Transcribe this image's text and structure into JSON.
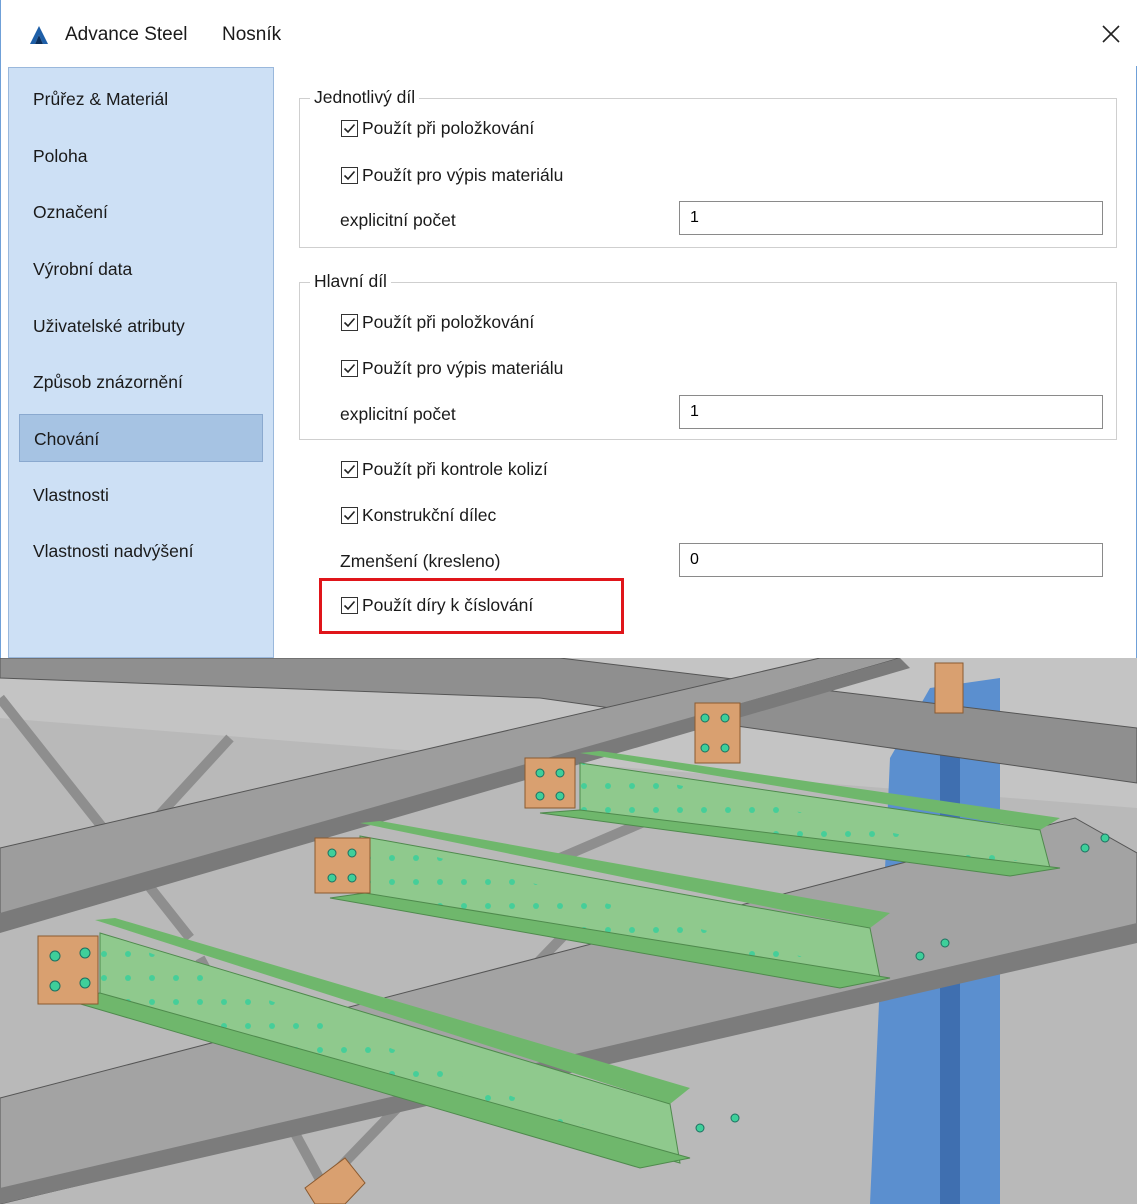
{
  "window": {
    "app_title": "Advance Steel",
    "object_title": "Nosník",
    "close_glyph": "✕"
  },
  "sidebar": {
    "items": [
      {
        "label": "Průřez & Materiál"
      },
      {
        "label": "Poloha"
      },
      {
        "label": "Označení"
      },
      {
        "label": "Výrobní data"
      },
      {
        "label": "Uživatelské atributy"
      },
      {
        "label": "Způsob znázornění"
      },
      {
        "label": "Chování",
        "active": true
      },
      {
        "label": "Vlastnosti"
      },
      {
        "label": "Vlastnosti nadvýšení"
      }
    ]
  },
  "groups": {
    "single": {
      "title": "Jednotlivý díl",
      "opt1": "Použít při položkování",
      "opt2": "Použít pro výpis materiálu",
      "count_label": "explicitní počet",
      "count_value": "1"
    },
    "main": {
      "title": "Hlavní díl",
      "opt1": "Použít při položkování",
      "opt2": "Použít pro výpis materiálu",
      "count_label": "explicitní počet",
      "count_value": "1"
    }
  },
  "options": {
    "collision": "Použít při kontrole kolizí",
    "structural": "Konstrukční dílec",
    "reduction_label": "Zmenšení (kresleno)",
    "reduction_value": "0",
    "holes_numbering": "Použít díry k číslování"
  },
  "colors": {
    "sidebar_bg": "#cde0f5",
    "active_item": "#a6c3e3",
    "highlight": "#e0151a",
    "beam_green": "#8fc98d",
    "beam_gray": "#9a9a9a",
    "column_blue": "#5b8fcf",
    "plate_orange": "#d9a070"
  },
  "icons": [
    "autodesk-logo-icon",
    "close-icon",
    "checkmark-icon"
  ]
}
